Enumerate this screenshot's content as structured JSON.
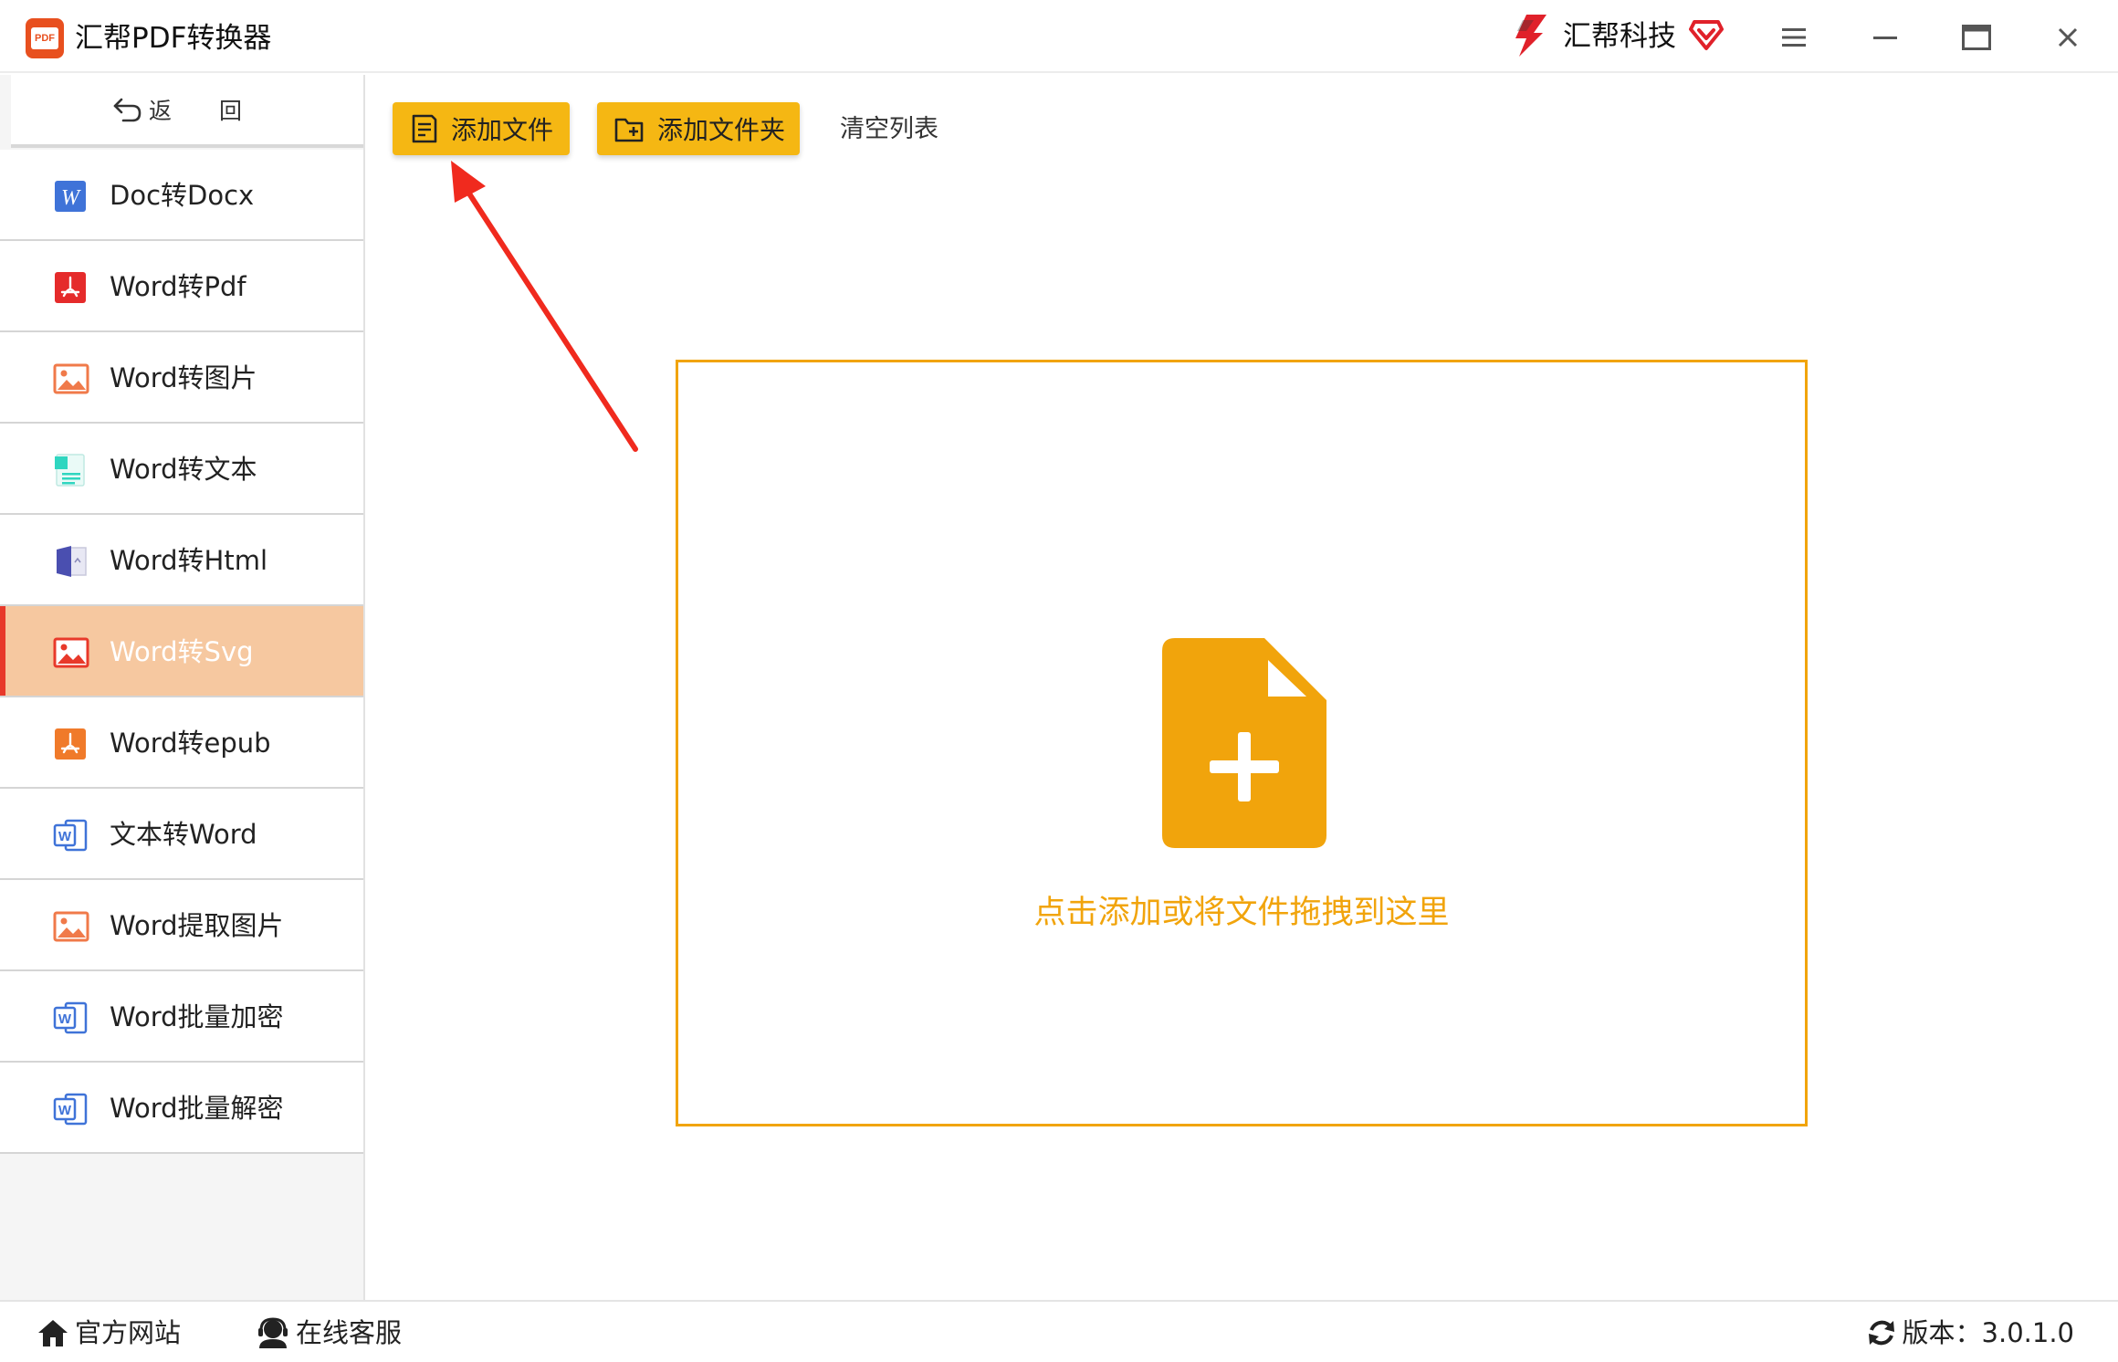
{
  "app": {
    "title": "汇帮PDF转换器",
    "logo_text": "PDF",
    "brand": "汇帮科技"
  },
  "window_controls": [
    "menu-icon",
    "minimize-icon",
    "maximize-icon",
    "close-icon"
  ],
  "sidebar": {
    "back_label": "返 回",
    "items": [
      {
        "label": "Doc转Docx",
        "icon": "word-w-icon"
      },
      {
        "label": "Word转Pdf",
        "icon": "pdf-icon"
      },
      {
        "label": "Word转图片",
        "icon": "image-icon"
      },
      {
        "label": "Word转文本",
        "icon": "text-file-icon"
      },
      {
        "label": "Word转Html",
        "icon": "html-book-icon"
      },
      {
        "label": "Word转Svg",
        "icon": "image-icon",
        "active": true
      },
      {
        "label": "Word转epub",
        "icon": "epub-icon"
      },
      {
        "label": "文本转Word",
        "icon": "word-doc-icon"
      },
      {
        "label": "Word提取图片",
        "icon": "image-icon"
      },
      {
        "label": "Word批量加密",
        "icon": "word-doc-icon"
      },
      {
        "label": "Word批量解密",
        "icon": "word-doc-icon"
      }
    ]
  },
  "toolbar": {
    "add_file": "添加文件",
    "add_folder": "添加文件夹",
    "clear_list": "清空列表"
  },
  "dropzone": {
    "hint": "点击添加或将文件拖拽到这里"
  },
  "statusbar": {
    "website": "官方网站",
    "support": "在线客服",
    "version": "版本：3.0.1.0"
  },
  "colors": {
    "accent": "#f5b713",
    "dropzone_border": "#f1a40c",
    "active_item_bg": "#f6c8a0",
    "active_indicator": "#e8392a",
    "annotation_arrow": "#f02a1e"
  }
}
